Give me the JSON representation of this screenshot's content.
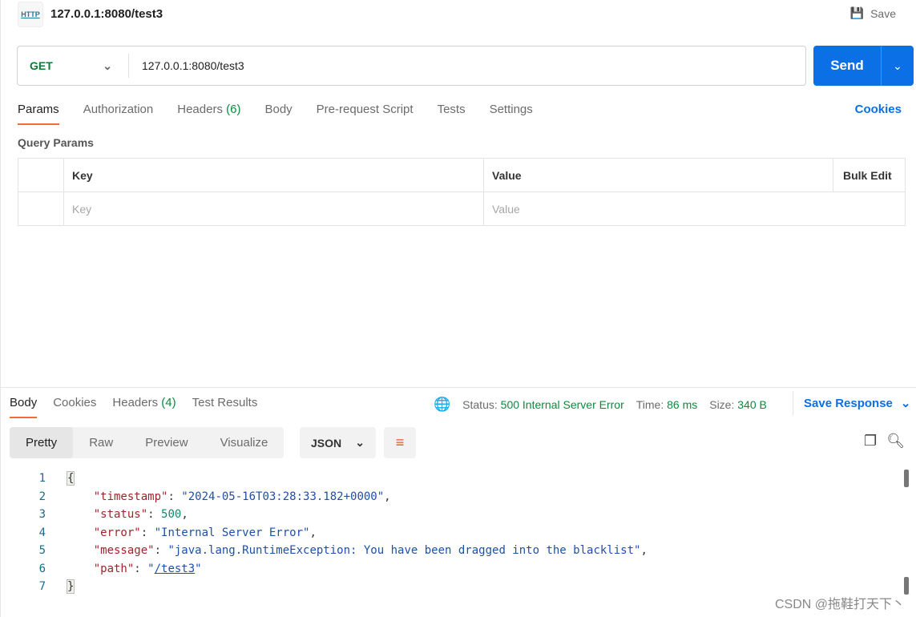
{
  "header": {
    "icon_text": "HTTP",
    "title": "127.0.0.1:8080/test3",
    "save_label": "Save"
  },
  "request": {
    "method": "GET",
    "url": "127.0.0.1:8080/test3",
    "send_label": "Send"
  },
  "tabs": [
    {
      "label": "Params"
    },
    {
      "label": "Authorization"
    },
    {
      "label": "Headers",
      "count": "(6)"
    },
    {
      "label": "Body"
    },
    {
      "label": "Pre-request Script"
    },
    {
      "label": "Tests"
    },
    {
      "label": "Settings"
    }
  ],
  "cookies_label": "Cookies",
  "query_params": {
    "title": "Query Params",
    "headers": {
      "key": "Key",
      "value": "Value",
      "bulk": "Bulk Edit"
    },
    "placeholder": {
      "key": "Key",
      "value": "Value"
    }
  },
  "response": {
    "tabs": [
      {
        "label": "Body"
      },
      {
        "label": "Cookies"
      },
      {
        "label": "Headers",
        "count": "(4)"
      },
      {
        "label": "Test Results"
      }
    ],
    "status_label": "Status:",
    "status": "500 Internal Server Error",
    "time_label": "Time:",
    "time": "86 ms",
    "size_label": "Size:",
    "size": "340 B",
    "save_response": "Save Response",
    "views": [
      "Pretty",
      "Raw",
      "Preview",
      "Visualize"
    ],
    "format": "JSON",
    "lines": [
      "1",
      "2",
      "3",
      "4",
      "5",
      "6",
      "7"
    ],
    "json": {
      "open": "{",
      "close": "}",
      "timestamp_key": "\"timestamp\"",
      "timestamp": "\"2024-05-16T03:28:33.182+0000\"",
      "status_key": "\"status\"",
      "status": "500",
      "error_key": "\"error\"",
      "error": "\"Internal Server Error\"",
      "message_key": "\"message\"",
      "message": "\"java.lang.RuntimeException: You have been dragged into the blacklist\"",
      "path_key": "\"path\"",
      "path_q": "\"",
      "path": "/test3"
    }
  },
  "watermark": "CSDN @拖鞋打天下丶"
}
